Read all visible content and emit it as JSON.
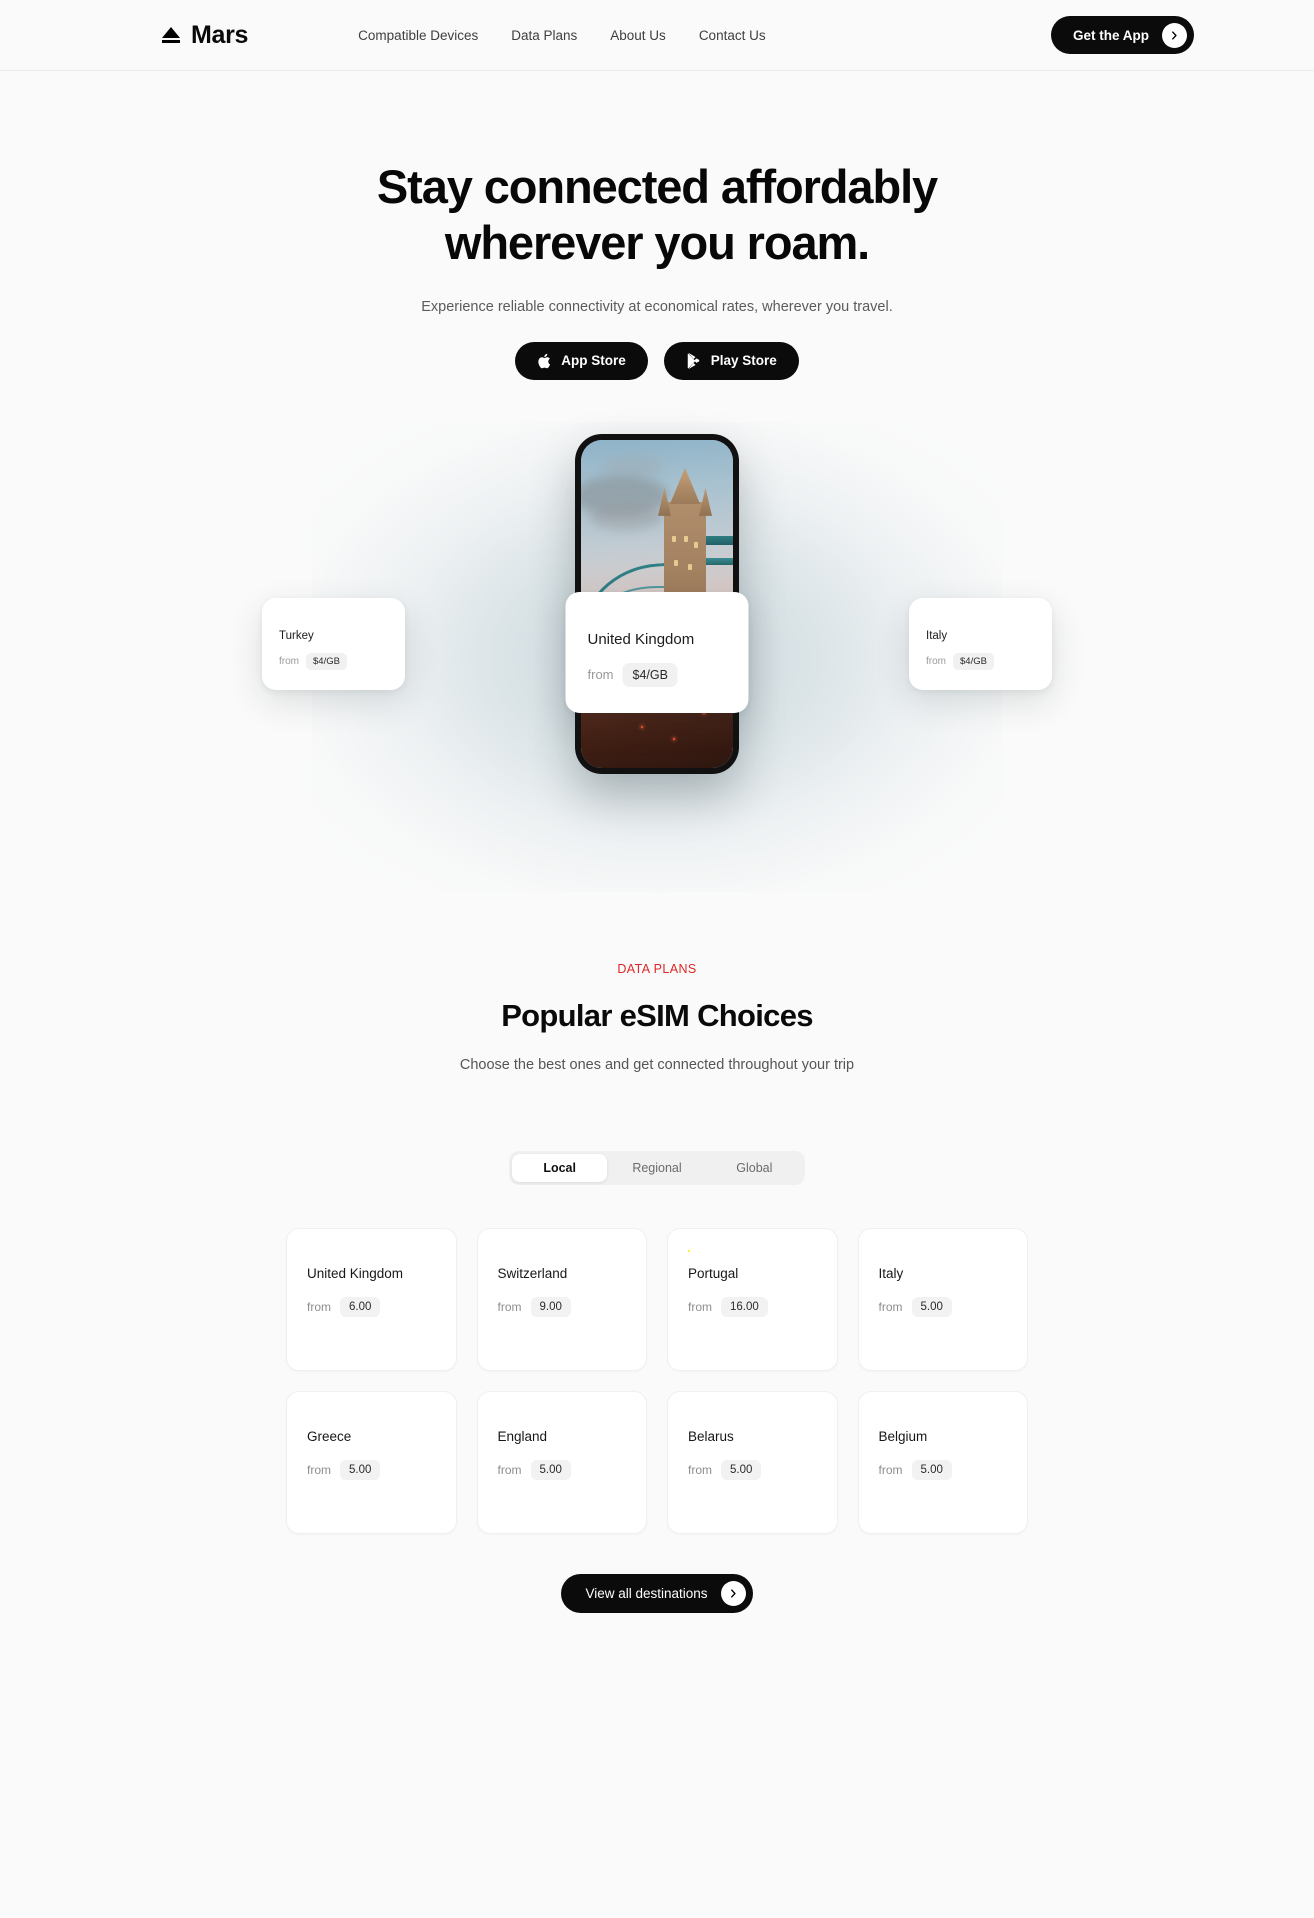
{
  "header": {
    "brand": "Mars",
    "brand_icon": "eject-triangle-logo",
    "nav": [
      {
        "label": "Compatible Devices"
      },
      {
        "label": "Data Plans"
      },
      {
        "label": "About Us"
      },
      {
        "label": "Contact Us"
      }
    ],
    "cta_label": "Get the App",
    "cta_icon": "chevron-right-icon"
  },
  "hero": {
    "headline_line1": "Stay connected affordably",
    "headline_line2": "wherever you roam.",
    "subtitle": "Experience reliable connectivity at economical rates, wherever you travel.",
    "buttons": [
      {
        "label": "App Store",
        "icon": "apple-icon"
      },
      {
        "label": "Play Store",
        "icon": "google-play-icon"
      }
    ]
  },
  "showcase": {
    "phone_image_alt": "tower-bridge-london-photo",
    "cards": [
      {
        "country": "Turkey",
        "flag": "turkey-flag-icon",
        "from_label": "from",
        "price": "$4/GB"
      },
      {
        "country": "United Kingdom",
        "flag": "united-kingdom-flag-icon",
        "from_label": "from",
        "price": "$4/GB"
      },
      {
        "country": "Italy",
        "flag": "italy-flag-icon",
        "from_label": "from",
        "price": "$4/GB"
      }
    ]
  },
  "plans": {
    "eyebrow": "DATA PLANS",
    "eyebrow_color": "#de2626",
    "title": "Popular eSIM Choices",
    "subtitle": "Choose the best ones and get connected throughout your trip",
    "tabs": [
      {
        "label": "Local",
        "active": true
      },
      {
        "label": "Regional",
        "active": false
      },
      {
        "label": "Global",
        "active": false
      }
    ],
    "from_label": "from",
    "countries": [
      {
        "name": "United Kingdom",
        "flag": "united-kingdom-flag-icon",
        "price": "6.00"
      },
      {
        "name": "Switzerland",
        "flag": "switzerland-flag-icon",
        "price": "9.00"
      },
      {
        "name": "Portugal",
        "flag": "portugal-flag-icon",
        "price": "16.00"
      },
      {
        "name": "Italy",
        "flag": "italy-flag-icon",
        "price": "5.00"
      },
      {
        "name": "Greece",
        "flag": "greece-flag-icon",
        "price": "5.00"
      },
      {
        "name": "England",
        "flag": "england-flag-icon",
        "price": "5.00"
      },
      {
        "name": "Belarus",
        "flag": "belarus-flag-icon",
        "price": "5.00"
      },
      {
        "name": "Belgium",
        "flag": "belgium-flag-icon",
        "price": "5.00"
      }
    ],
    "view_all_label": "View all destinations",
    "view_all_icon": "chevron-right-icon"
  },
  "theme": {
    "page_background": "#fafafa",
    "accent_dark": "#0b0b0b",
    "accent_red": "#de2626",
    "card_background": "#ffffff"
  }
}
